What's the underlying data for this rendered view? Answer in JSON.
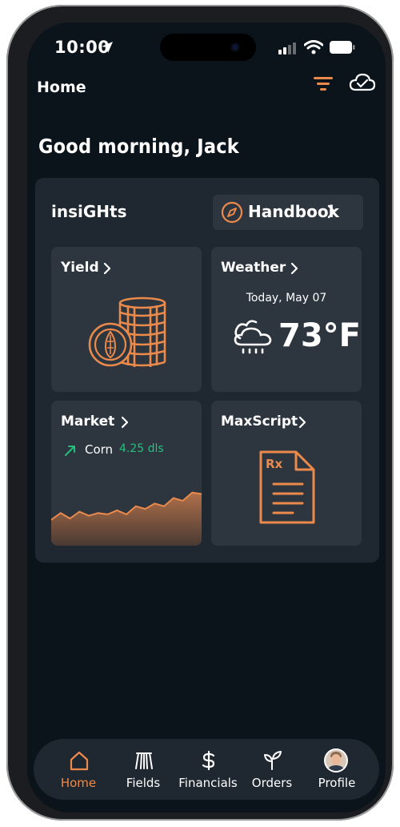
{
  "status_bar": {
    "time": "10:00"
  },
  "header": {
    "title": "Home"
  },
  "greeting": "Good morning, Jack",
  "insights": {
    "title": "insiGHts",
    "handbook_label": "Handbook"
  },
  "cards": {
    "yield": {
      "title": "Yield"
    },
    "weather": {
      "title": "Weather",
      "date": "Today, May 07",
      "temperature": "73°F"
    },
    "market": {
      "title": "Market",
      "crop": "Corn",
      "price": "4.25 dls",
      "sparkline": [
        0.38,
        0.48,
        0.4,
        0.5,
        0.44,
        0.48,
        0.46,
        0.52,
        0.46,
        0.58,
        0.54,
        0.62,
        0.58,
        0.7,
        0.66,
        0.78,
        0.76
      ]
    },
    "maxscript": {
      "title": "MaxScript"
    }
  },
  "nav": {
    "items": [
      {
        "label": "Home",
        "icon": "home-icon",
        "active": true
      },
      {
        "label": "Fields",
        "icon": "fields-icon",
        "active": false
      },
      {
        "label": "Financials",
        "icon": "dollar-icon",
        "active": false
      },
      {
        "label": "Orders",
        "icon": "sprout-icon",
        "active": false
      },
      {
        "label": "Profile",
        "icon": "avatar",
        "active": false
      }
    ]
  },
  "colors": {
    "accent": "#ec8a4c",
    "background": "#0b141b",
    "panel": "#1f2731",
    "card": "#2d353f",
    "positive": "#22c07c"
  }
}
